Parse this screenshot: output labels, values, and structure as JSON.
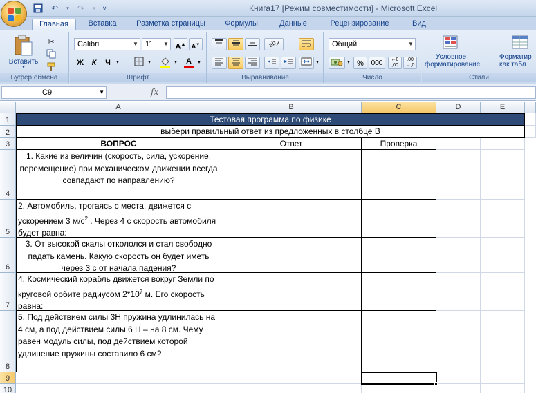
{
  "window": {
    "title": "Книга17  [Режим совместимости] - Microsoft Excel"
  },
  "ribbon": {
    "tabs": [
      "Главная",
      "Вставка",
      "Разметка страницы",
      "Формулы",
      "Данные",
      "Рецензирование",
      "Вид"
    ],
    "active_tab": "Главная",
    "clipboard": {
      "paste_label": "Вставить",
      "group_label": "Буфер обмена"
    },
    "font": {
      "name": "Calibri",
      "size": "11",
      "bold": "Ж",
      "italic": "К",
      "underline": "Ч",
      "group_label": "Шрифт"
    },
    "alignment": {
      "group_label": "Выравнивание"
    },
    "number": {
      "format": "Общий",
      "percent": "%",
      "thousands": "000",
      "group_label": "Число"
    },
    "styles": {
      "conditional_line1": "Условное",
      "conditional_line2": "форматирование",
      "format_table_line1": "Форматир",
      "format_table_line2": "как табл",
      "group_label": "Стили"
    }
  },
  "formula_bar": {
    "name_box": "C9",
    "fx": "fx",
    "formula": ""
  },
  "sheet": {
    "columns": [
      "A",
      "B",
      "C",
      "D",
      "E"
    ],
    "selected_column": "C",
    "rows": [
      "1",
      "2",
      "3",
      "4",
      "5",
      "6",
      "7",
      "8",
      "9",
      "10"
    ],
    "selected_row": "9",
    "title": "Тестовая программа по физике",
    "subtitle": "выбери правильный ответ из предложенных в столбце В",
    "headers": {
      "question": "ВОПРОС",
      "answer": "Ответ",
      "check": "Проверка"
    },
    "questions": [
      "1. Какие из величин (скорость, сила, ускорение, перемещение) при механическом движении всегда совпадают по направлению?",
      "2. Автомобиль, трогаясь с места, движется с ускорением 3 м/с",
      "3. От высокой скалы откололся и стал свободно падать камень. Какую скорость он будет иметь через 3 с от начала падения?",
      "4. Космический корабль движется вокруг Земли по круговой орбите радиусом 2*10",
      "5. Под действием силы 3Н пружина удлинилась на 4 см, а под действием силы 6 Н – на 8 см. Чему равен модуль силы, под действием  которой удлинение пружины составило 6 см?"
    ],
    "q2_sup": "2",
    "q2_tail": " . Через 4 с скорость автомобиля будет равна:",
    "q4_sup": "7",
    "q4_tail": " м. Его скорость равна:"
  },
  "colors": {
    "title_fill": "#2e4b78",
    "subtitle_fill": "#ffffff",
    "ribbon_text": "#15428b"
  }
}
